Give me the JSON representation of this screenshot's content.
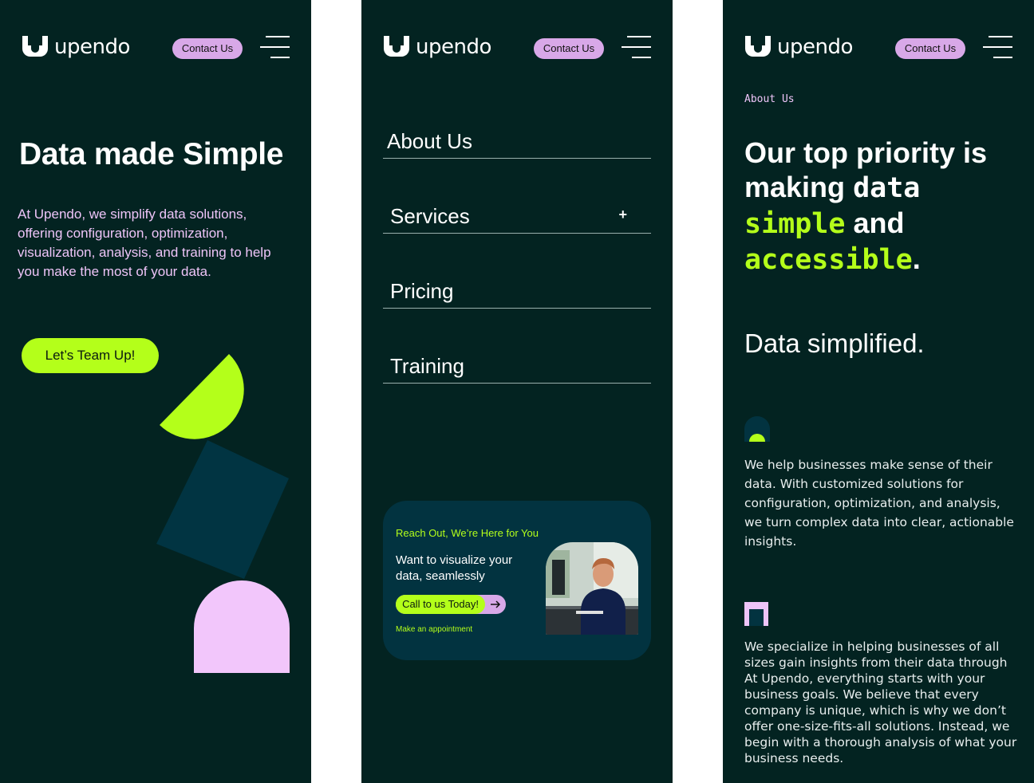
{
  "brand": {
    "name": "upendo",
    "contact_label": "Contact Us",
    "colors": {
      "background": "#032321",
      "accent_lime": "#b4ff1a",
      "accent_pink": "#d8a8e8",
      "accent_teal": "#023340"
    }
  },
  "home": {
    "title": "Data made Simple",
    "intro": "At Upendo, we simplify data solutions, offering configuration, optimization, visualization, analysis, and training to help you make the most of your data.",
    "cta_label": "Let’s Team Up!"
  },
  "menu": {
    "items": [
      {
        "label": "About Us",
        "expandable": false
      },
      {
        "label": "Services",
        "expandable": true
      },
      {
        "label": "Pricing",
        "expandable": false
      },
      {
        "label": "Training",
        "expandable": false
      }
    ],
    "card": {
      "kicker": "Reach Out, We’re Here for You",
      "title": "Want to visualize your data, seamlessly",
      "call_label": "Call to us Today!",
      "link_label": "Make an appointment"
    }
  },
  "about": {
    "eyebrow": "About Us",
    "headline": {
      "part1": "Our top priority is making",
      "word1": "data",
      "word2": "simple",
      "part2": "and",
      "word3": "accessible",
      "end": "."
    },
    "subtitle": "Data simplified.",
    "para1": "We help businesses make sense of their data. With customized solutions for configuration, optimization, and analysis, we turn complex data into clear, actionable insights.",
    "para2": "We specialize in helping businesses of all sizes gain insights from their data through At Upendo, everything starts with your business goals. We believe that every company is unique, which is why we don’t offer one-size-fits-all solutions. Instead, we begin with a thorough analysis of what your business needs."
  }
}
